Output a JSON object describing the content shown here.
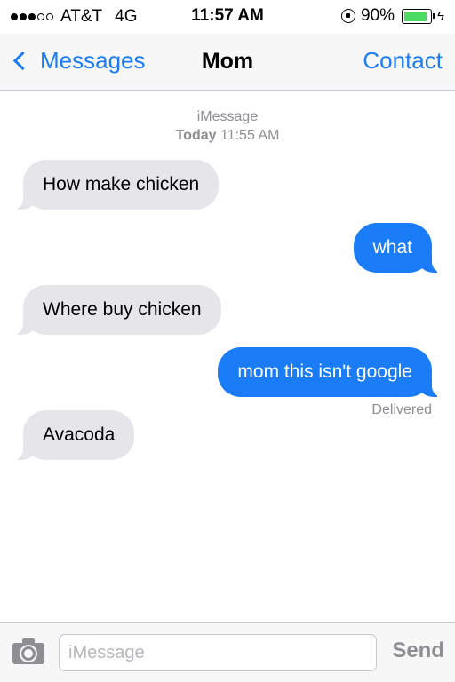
{
  "status_bar": {
    "signal_dots": [
      true,
      true,
      true,
      false,
      false
    ],
    "carrier": "AT&T",
    "network": "4G",
    "time": "11:57 AM",
    "battery_percent": "90%",
    "battery_level": 0.9,
    "battery_color": "#4cd964",
    "icons": [
      "rotation-lock-icon",
      "battery-icon",
      "charging-bolt-icon"
    ]
  },
  "nav": {
    "back_label": "Messages",
    "title": "Mom",
    "action_label": "Contact",
    "accent_color": "#1b7cf7"
  },
  "thread": {
    "service": "iMessage",
    "date_label": "Today",
    "date_time": "11:55 AM",
    "messages": [
      {
        "direction": "incoming",
        "text": "How make chicken"
      },
      {
        "direction": "outgoing",
        "text": "what"
      },
      {
        "direction": "incoming",
        "text": "Where buy chicken"
      },
      {
        "direction": "outgoing",
        "text": "mom this isn't google",
        "status": "Delivered"
      },
      {
        "direction": "incoming",
        "text": "Avacoda"
      }
    ],
    "incoming_color": "#e5e5ea",
    "outgoing_color": "#1b7cf7"
  },
  "input_bar": {
    "camera_icon": "camera-icon",
    "placeholder": "iMessage",
    "value": "",
    "send_label": "Send"
  }
}
